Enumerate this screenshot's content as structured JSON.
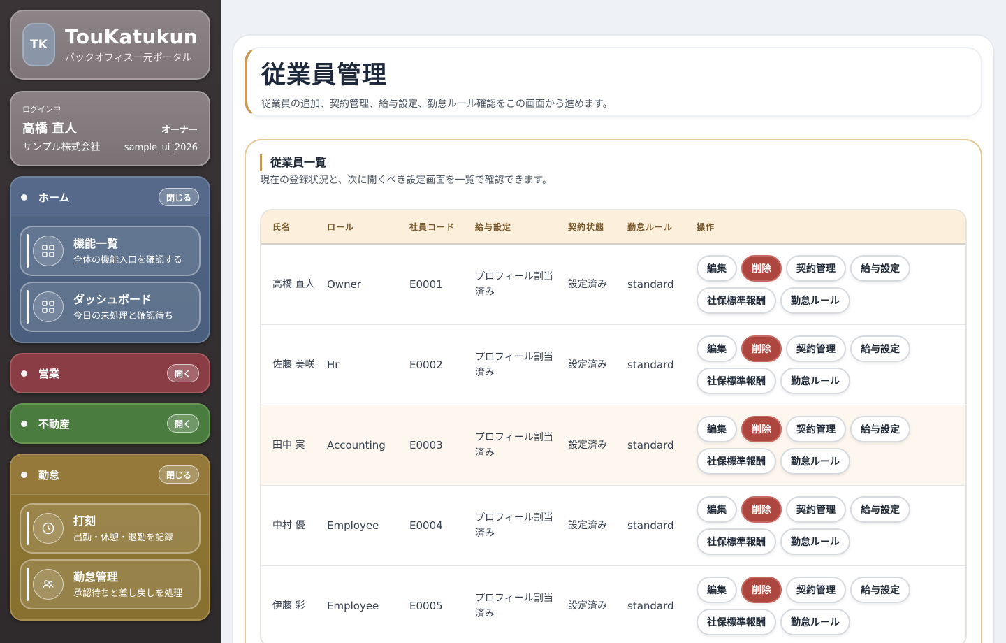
{
  "brand": {
    "logo": "TK",
    "name": "TouKatukun",
    "subtitle": "バックオフィス一元ポータル"
  },
  "login": {
    "label": "ログイン中",
    "user": "高橋 直人",
    "role": "オーナー",
    "company": "サンプル株式会社",
    "account": "sample_ui_2026"
  },
  "sidebar": {
    "home": {
      "title": "ホーム",
      "toggle": "閉じる",
      "items": [
        {
          "title": "機能一覧",
          "desc": "全体の機能入口を確認する",
          "icon": "grid-icon"
        },
        {
          "title": "ダッシュボード",
          "desc": "今日の未処理と確認待ち",
          "icon": "grid-icon"
        }
      ]
    },
    "sales": {
      "title": "営業",
      "toggle": "開く"
    },
    "estate": {
      "title": "不動産",
      "toggle": "開く"
    },
    "attendance": {
      "title": "勤怠",
      "toggle": "閉じる",
      "items": [
        {
          "title": "打刻",
          "desc": "出勤・休憩・退勤を記録",
          "icon": "clock-icon"
        },
        {
          "title": "勤怠管理",
          "desc": "承認待ちと差し戻しを処理",
          "icon": "users-icon"
        }
      ]
    }
  },
  "page": {
    "title": "従業員管理",
    "description": "従業員の追加、契約管理、給与設定、勤怠ルール確認をこの画面から進めます。"
  },
  "list": {
    "title": "従業員一覧",
    "description": "現在の登録状況と、次に開くべき設定画面を一覧で確認できます。",
    "columns": [
      "氏名",
      "ロール",
      "社員コード",
      "給与設定",
      "契約状態",
      "勤怠ルール",
      "操作"
    ],
    "actions": [
      "編集",
      "削除",
      "契約管理",
      "給与設定",
      "社保標準報酬",
      "勤怠ルール"
    ],
    "rows": [
      {
        "name": "高橋 直人",
        "role": "Owner",
        "code": "E0001",
        "payroll": "プロフィール割当済み",
        "contract": "設定済み",
        "rule": "standard"
      },
      {
        "name": "佐藤 美咲",
        "role": "Hr",
        "code": "E0002",
        "payroll": "プロフィール割当済み",
        "contract": "設定済み",
        "rule": "standard"
      },
      {
        "name": "田中 実",
        "role": "Accounting",
        "code": "E0003",
        "payroll": "プロフィール割当済み",
        "contract": "設定済み",
        "rule": "standard"
      },
      {
        "name": "中村 優",
        "role": "Employee",
        "code": "E0004",
        "payroll": "プロフィール割当済み",
        "contract": "設定済み",
        "rule": "standard"
      },
      {
        "name": "伊藤 彩",
        "role": "Employee",
        "code": "E0005",
        "payroll": "プロフィール割当済み",
        "contract": "設定済み",
        "rule": "standard"
      }
    ]
  },
  "colors": {
    "accent": "#c79a56",
    "delete": "#ad463f",
    "home": "#4f6585",
    "sales": "#8a3d45",
    "estate": "#4a7b3f",
    "attendance": "#8e7432"
  }
}
